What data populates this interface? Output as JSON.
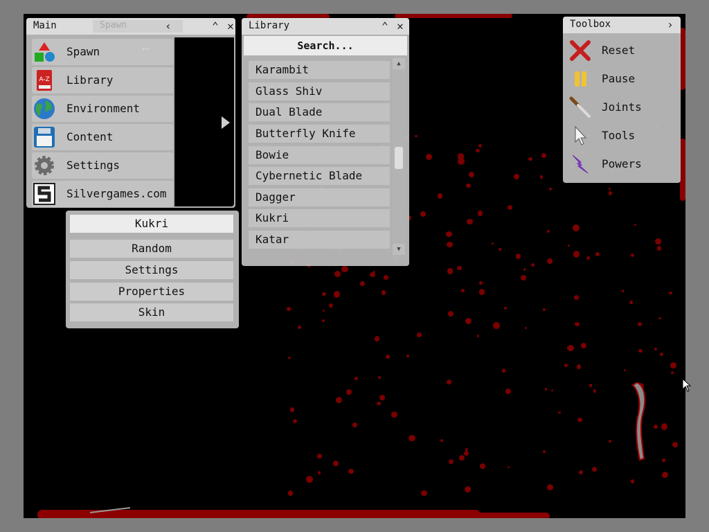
{
  "main_panel": {
    "title": "Main",
    "ghost_tab": "Spawn",
    "items": [
      {
        "label": "Spawn",
        "icon": "shapes-icon"
      },
      {
        "label": "Library",
        "icon": "library-book-icon"
      },
      {
        "label": "Environment",
        "icon": "globe-icon"
      },
      {
        "label": "Content",
        "icon": "floppy-disk-icon"
      },
      {
        "label": "Settings",
        "icon": "gear-icon"
      },
      {
        "label": "Silvergames.com",
        "icon": "silvergames-logo-icon"
      }
    ],
    "library_icon_text": "A-Z"
  },
  "sub_menu": {
    "selected_item": "Kukri",
    "buttons": [
      "Random",
      "Settings",
      "Properties",
      "Skin"
    ]
  },
  "library_panel": {
    "title": "Library",
    "search_placeholder": "Search...",
    "items": [
      "Karambit",
      "Glass Shiv",
      "Dual Blade",
      "Butterfly Knife",
      "Bowie",
      "Cybernetic Blade",
      "Dagger",
      "Kukri",
      "Katar"
    ]
  },
  "toolbox": {
    "title": "Toolbox",
    "items": [
      {
        "label": "Reset",
        "icon": "red-x-icon"
      },
      {
        "label": "Pause",
        "icon": "pause-icon"
      },
      {
        "label": "Joints",
        "icon": "knife-joint-icon"
      },
      {
        "label": "Tools",
        "icon": "pointer-icon"
      },
      {
        "label": "Powers",
        "icon": "lightning-icon"
      }
    ]
  },
  "colors": {
    "arena_background": "#000000",
    "frame": "#7e7e7e",
    "blood": "#8b0000",
    "panel": "#bebebe"
  }
}
